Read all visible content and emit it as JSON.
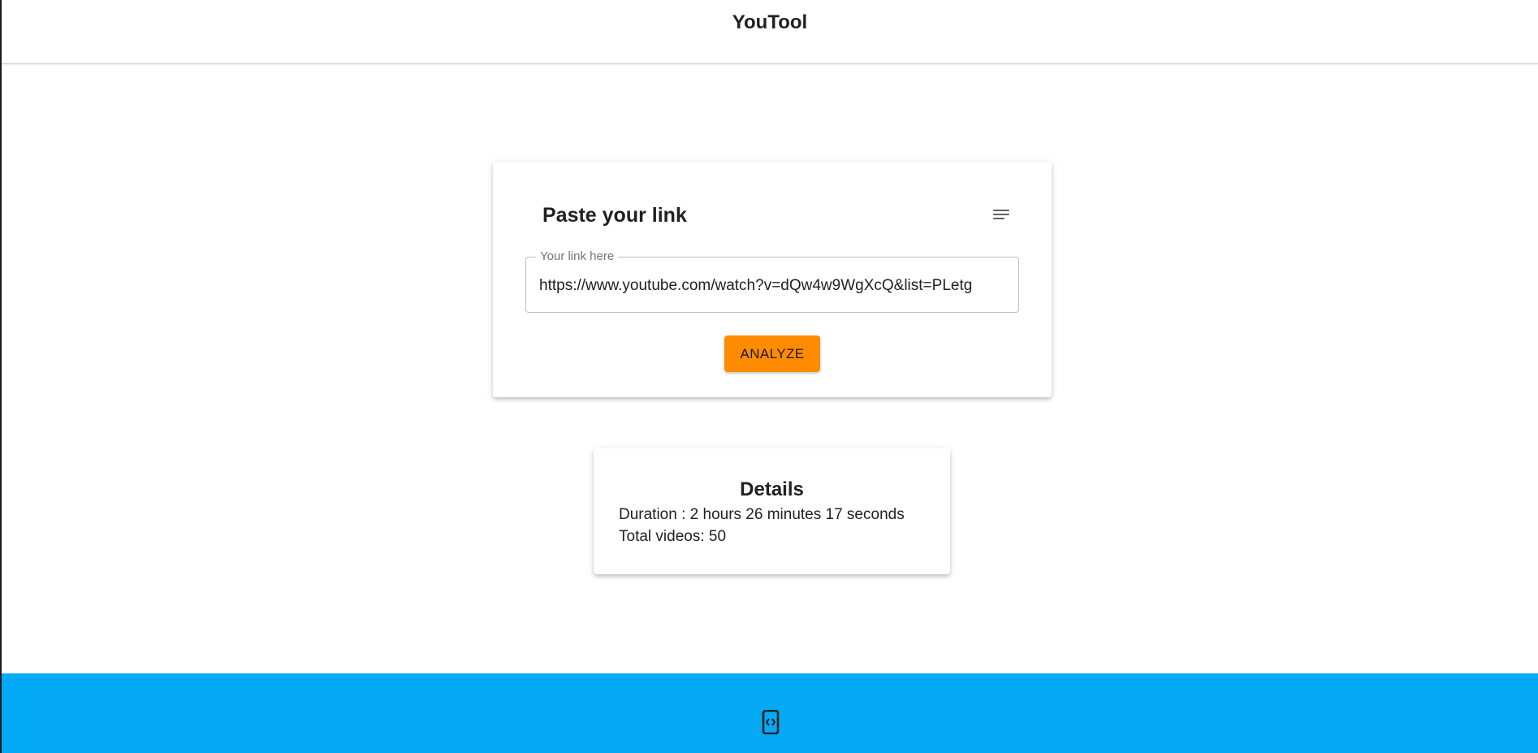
{
  "header": {
    "title": "YouTool"
  },
  "link_card": {
    "title": "Paste your link",
    "menu_icon": "menu-lines-icon",
    "input": {
      "label": "Your link here",
      "value": "https://www.youtube.com/watch?v=dQw4w9WgXcQ&list=PLetg"
    },
    "analyze_label": "ANALYZE"
  },
  "details": {
    "title": "Details",
    "duration": "Duration : 2 hours 26 minutes 17 seconds",
    "total_videos": "Total videos: 50"
  },
  "footer": {
    "icon": "developer-mode-icon"
  },
  "colors": {
    "accent_orange": "#ff8c00",
    "footer_blue": "#03a9f4",
    "text": "#212121"
  }
}
